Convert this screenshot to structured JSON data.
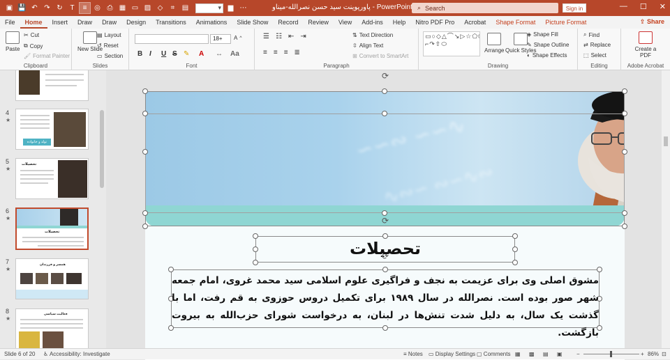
{
  "app": {
    "name": "PowerPoint",
    "doc_title": "پاورپوینت سید حسن نصرالله-میناو",
    "separator": "-"
  },
  "search": {
    "placeholder": "Search"
  },
  "account": {
    "sign_in": "Sign in"
  },
  "tabs": [
    "File",
    "Home",
    "Insert",
    "Draw",
    "Draw",
    "Design",
    "Transitions",
    "Animations",
    "Slide Show",
    "Record",
    "Review",
    "View",
    "Add-ins",
    "Help",
    "Nitro PDF Pro",
    "Acrobat",
    "Shape Format",
    "Picture Format"
  ],
  "share_label": "Share",
  "ribbon": {
    "clipboard": {
      "label": "Clipboard",
      "paste": "Paste",
      "cut": "Cut",
      "copy": "Copy",
      "format_painter": "Format Painter"
    },
    "slides": {
      "label": "Slides",
      "new_slide": "New Slide",
      "layout": "Layout",
      "reset": "Reset",
      "section": "Section"
    },
    "font": {
      "label": "Font",
      "font_name": "",
      "font_size": "18+",
      "bold": "B",
      "italic": "I",
      "underline": "U",
      "strike": "S"
    },
    "paragraph": {
      "label": "Paragraph",
      "text_direction": "Text Direction",
      "align_text": "Align Text",
      "convert_smartart": "Convert to SmartArt"
    },
    "drawing": {
      "label": "Drawing",
      "arrange": "Arrange",
      "quick_styles": "Quick Styles",
      "shape_fill": "Shape Fill",
      "shape_outline": "Shape Outline",
      "shape_effects": "Shape Effects"
    },
    "editing": {
      "label": "Editing",
      "find": "Find",
      "replace": "Replace",
      "select": "Select"
    },
    "acrobat": {
      "label": "Adobe Acrobat",
      "create_pdf": "Create a PDF"
    }
  },
  "thumbnails": [
    {
      "num": "4",
      "star": "★"
    },
    {
      "num": "5",
      "star": "★",
      "title": "تحصیلات"
    },
    {
      "num": "6",
      "star": "★",
      "title": "تحصیلات",
      "selected": true
    },
    {
      "num": "7",
      "star": "★",
      "title": "همسر و فرزندان"
    },
    {
      "num": "8",
      "star": "★",
      "title": "فعالیت سیاسی"
    }
  ],
  "thumb4_caption": "تولد و خانواده",
  "slide": {
    "title": "تحصیلات",
    "body": "مشوق اصلی وی برای عزیمت به نجف و فراگیری علوم اسلامی سید محمد غروی، امام جمعه شهر صور بوده است. نصرالله در سال ۱۹۸۹ برای تکمیل دروس حوزوی به قم رفت، اما با گذشت یک سال، به دلیل شدت تنش‌ها در لبنان، به درخواست شورای حزب‌الله به بیروت بازگشت."
  },
  "status": {
    "slide_info": "Slide 6 of 20",
    "accessibility": "Accessibility: Investigate",
    "notes": "Notes",
    "display_settings": "Display Settings",
    "comments": "Comments",
    "zoom": "86%"
  },
  "colors": {
    "accent": "#b7472a",
    "teal": "#8fd6d3",
    "selection": "#c14a2c"
  }
}
